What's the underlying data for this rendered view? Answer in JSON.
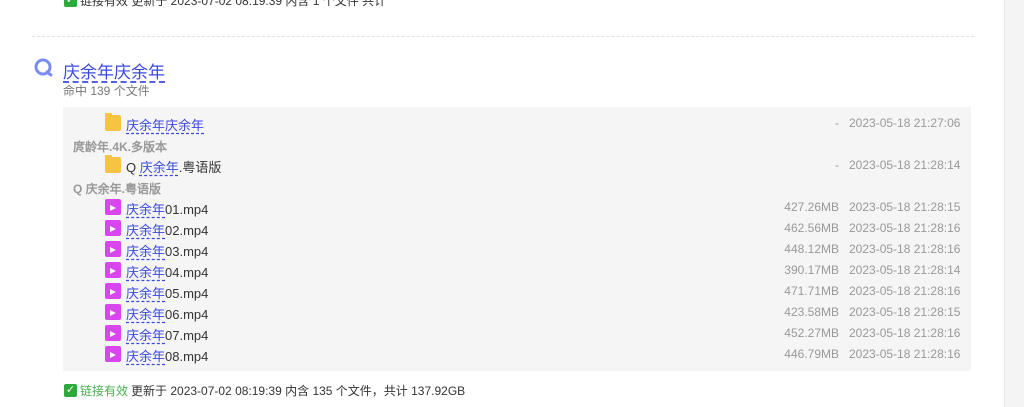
{
  "top_status": {
    "text": "链接有效 更新于 2023-07-02 08:19:39 内含 1 个文件 共计"
  },
  "result": {
    "title": "庆余年庆余年",
    "hit_count": "命中 139 个文件"
  },
  "rows": [
    {
      "kind": "folder",
      "hl": "庆余年庆余年",
      "rest": "",
      "prefix": "",
      "size": "-",
      "date": "2023-05-18 21:27:06"
    },
    {
      "kind": "subpath",
      "text": "庹龄年.4K.多版本"
    },
    {
      "kind": "folder",
      "prefix": "Q ",
      "hl": "庆余年",
      "rest": ".粤语版",
      "size": "-",
      "date": "2023-05-18 21:28:14"
    },
    {
      "kind": "subpath",
      "text": "Q 庆余年.粤语版"
    },
    {
      "kind": "video",
      "prefix": "",
      "hl": "庆余年",
      "rest": "01.mp4",
      "size": "427.26MB",
      "date": "2023-05-18 21:28:15"
    },
    {
      "kind": "video",
      "prefix": "",
      "hl": "庆余年",
      "rest": "02.mp4",
      "size": "462.56MB",
      "date": "2023-05-18 21:28:16"
    },
    {
      "kind": "video",
      "prefix": "",
      "hl": "庆余年",
      "rest": "03.mp4",
      "size": "448.12MB",
      "date": "2023-05-18 21:28:16"
    },
    {
      "kind": "video",
      "prefix": "",
      "hl": "庆余年",
      "rest": "04.mp4",
      "size": "390.17MB",
      "date": "2023-05-18 21:28:14"
    },
    {
      "kind": "video",
      "prefix": "",
      "hl": "庆余年",
      "rest": "05.mp4",
      "size": "471.71MB",
      "date": "2023-05-18 21:28:16"
    },
    {
      "kind": "video",
      "prefix": "",
      "hl": "庆余年",
      "rest": "06.mp4",
      "size": "423.58MB",
      "date": "2023-05-18 21:28:15"
    },
    {
      "kind": "video",
      "prefix": "",
      "hl": "庆余年",
      "rest": "07.mp4",
      "size": "452.27MB",
      "date": "2023-05-18 21:28:16"
    },
    {
      "kind": "video",
      "prefix": "",
      "hl": "庆余年",
      "rest": "08.mp4",
      "size": "446.79MB",
      "date": "2023-05-18 21:28:16"
    }
  ],
  "bottom_status": {
    "valid_label": "链接有效",
    "details": "更新于 2023-07-02 08:19:39 内含 135 个文件，共计 137.92GB"
  },
  "colors": {
    "link": "#3b49df",
    "valid": "#4caf50",
    "folder": "#f6c343",
    "video": "#d946ef",
    "muted": "#999999"
  },
  "icons": {
    "result_logo": "search-engine-logo-icon",
    "folder": "folder-icon",
    "video": "video-file-icon",
    "check": "check-icon"
  }
}
